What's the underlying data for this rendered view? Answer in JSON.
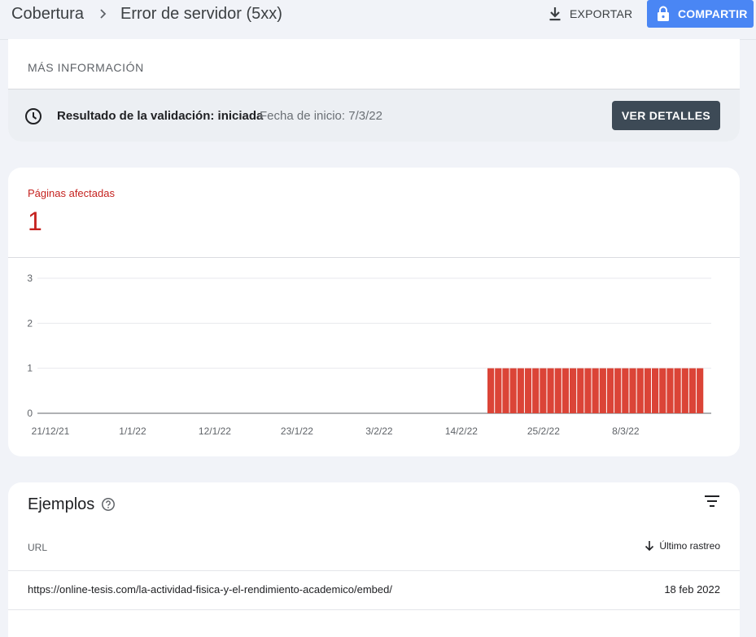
{
  "header": {
    "breadcrumb_root": "Cobertura",
    "page_title": "Error de servidor (5xx)",
    "export_label": "EXPORTAR",
    "share_label": "COMPARTIR"
  },
  "info": {
    "more_info_label": "MÁS INFORMACIÓN",
    "validation_label": "Resultado de la validación: iniciada",
    "validation_date": "Fecha de inicio: 7/3/22",
    "details_button": "VER DETALLES"
  },
  "affected": {
    "label": "Páginas afectadas",
    "count": "1"
  },
  "chart_data": {
    "type": "bar",
    "ylim": [
      0,
      3
    ],
    "yticks": [
      "0",
      "1",
      "2",
      "3"
    ],
    "xticks": [
      "21/12/21",
      "1/1/22",
      "12/1/22",
      "23/1/22",
      "3/2/22",
      "14/2/22",
      "25/2/22",
      "8/3/22"
    ],
    "series": [
      {
        "x": [
          "18/2/22",
          "19/2/22",
          "20/2/22",
          "21/2/22",
          "22/2/22",
          "23/2/22",
          "24/2/22",
          "25/2/22",
          "26/2/22",
          "27/2/22",
          "28/2/22",
          "1/3/22",
          "2/3/22",
          "3/3/22",
          "4/3/22",
          "5/3/22",
          "6/3/22",
          "7/3/22",
          "8/3/22",
          "9/3/22",
          "10/3/22",
          "11/3/22",
          "12/3/22",
          "13/3/22",
          "14/3/22",
          "15/3/22",
          "16/3/22",
          "17/3/22",
          "18/3/22"
        ],
        "values": [
          1,
          1,
          1,
          1,
          1,
          1,
          1,
          1,
          1,
          1,
          1,
          1,
          1,
          1,
          1,
          1,
          1,
          1,
          1,
          1,
          1,
          1,
          1,
          1,
          1,
          1,
          1,
          1,
          1
        ]
      }
    ],
    "bar_color": "#db4437"
  },
  "examples": {
    "title": "Ejemplos",
    "col_url": "URL",
    "col_last": "Último rastreo",
    "rows": [
      {
        "url": "https://online-tesis.com/la-actividad-fisica-y-el-rendimiento-academico/embed/",
        "date": "18 feb 2022"
      }
    ]
  },
  "colors": {
    "accent": "#4a86f4",
    "error": "#c5221f",
    "dark_button": "#3d4a56"
  }
}
